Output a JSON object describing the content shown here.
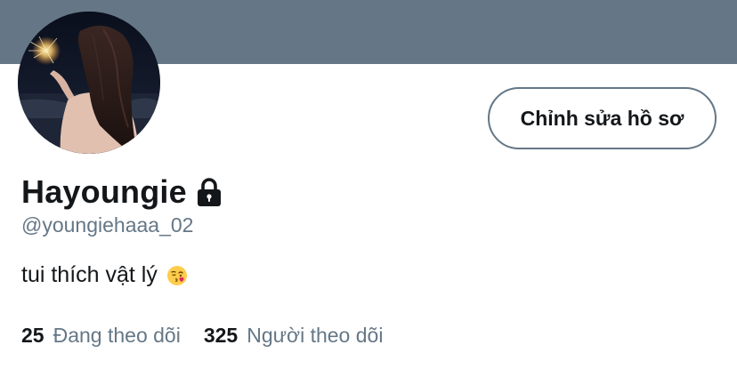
{
  "profile": {
    "display_name": "Hayoungie",
    "handle": "@youngiehaaa_02",
    "bio": "tui thích vật lý",
    "bio_emoji": "face-throwing-kiss-emoji",
    "protected": true
  },
  "actions": {
    "edit_profile_label": "Chỉnh sửa hồ sơ"
  },
  "stats": {
    "following_count": "25",
    "following_label": "Đang theo dõi",
    "followers_count": "325",
    "followers_label": "Người theo dõi"
  },
  "icons": {
    "lock": "lock-icon"
  },
  "colors": {
    "banner": "#657786",
    "text_primary": "#14171a",
    "text_secondary": "#657786",
    "button_border": "#657786"
  }
}
